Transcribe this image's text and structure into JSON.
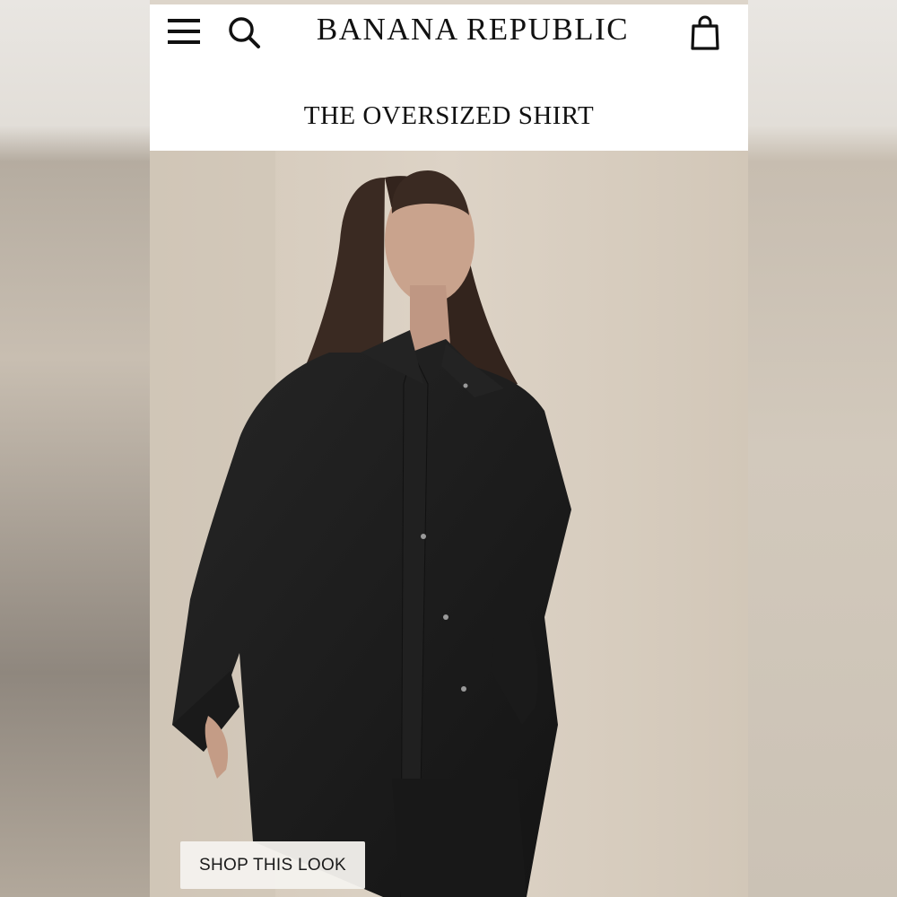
{
  "header": {
    "brand": "BANANA REPUBLIC",
    "menu_icon": "hamburger-menu-icon",
    "search_icon": "search-icon",
    "bag_icon": "shopping-bag-icon"
  },
  "promo": {
    "headline": "THE OVERSIZED SHIRT",
    "cta_label": "SHOP THIS LOOK"
  },
  "colors": {
    "text": "#111111",
    "shirt": "#1c1c1c",
    "backdrop": "#d9cfc2",
    "cta_background": "#f4f2ee"
  }
}
